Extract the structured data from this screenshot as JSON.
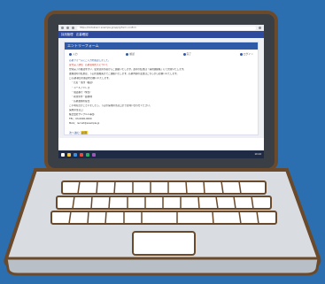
{
  "browser": {
    "url": "https://kintaikanri.example.jp/apply/form-confirm"
  },
  "app": {
    "header": "採用管理　応募確認"
  },
  "form": {
    "title": "エントリーフォーム",
    "steps": [
      "入力",
      "確認",
      "完了",
      "ログイン"
    ],
    "intro": "応募フォームにご入力を確認しました。",
    "section_heading": "受付完了通知　応募者様控えについて",
    "lines": [
      "登録完了の確認を行い、結果は担当者からご連絡いたします。選考の結果は「採用連絡帳」にて管理いたします。",
      "書類選考の結果は、下記の連絡先までご連絡いたします。応募内容の変更はこちらからお願いいたします。",
      "",
      "□ 応募項目の確認をお願いいたします。",
      "　・氏名・住所（確認）",
      "　・メールアドレス",
      "　・電話番号（緊急）",
      "　・希望条件・勤務地",
      "　・応募書類の提出",
      "",
      "ご不明な点がございましたら、下記の採用担当窓口までお問い合わせください。",
      "採用担当窓口",
      "株式会社サンプル人事部",
      "TEL：03-0000-0000",
      "MAIL：recruit@example.jp"
    ],
    "footer_link": "次へ進む",
    "badge": "必須"
  },
  "taskbar": {
    "clock": "10:24"
  }
}
